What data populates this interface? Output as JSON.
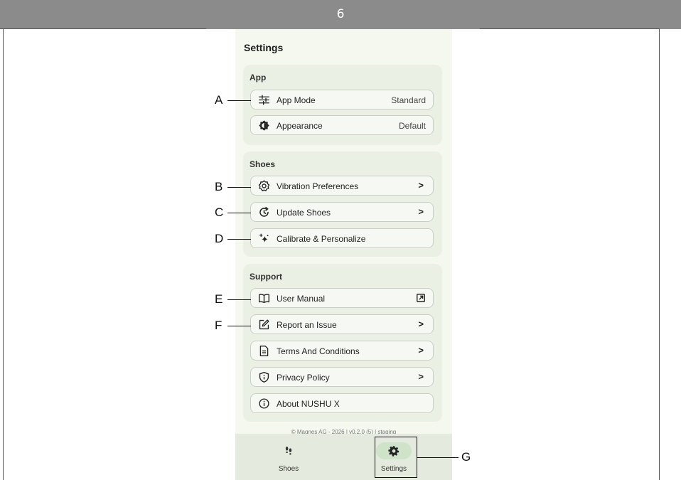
{
  "doc": {
    "page_number": "6"
  },
  "screen": {
    "title": "Settings",
    "sections": [
      {
        "title": "App",
        "rows": [
          {
            "label": "App Mode",
            "value": "Standard",
            "icon": "sliders-icon"
          },
          {
            "label": "Appearance",
            "value": "Default",
            "icon": "appearance-icon"
          }
        ]
      },
      {
        "title": "Shoes",
        "rows": [
          {
            "label": "Vibration Preferences",
            "chevron": ">",
            "icon": "vibration-icon"
          },
          {
            "label": "Update Shoes",
            "chevron": ">",
            "icon": "update-icon"
          },
          {
            "label": "Calibrate & Personalize",
            "icon": "sparkle-icon"
          }
        ]
      },
      {
        "title": "Support",
        "rows": [
          {
            "label": "User Manual",
            "icon": "book-icon",
            "trailing_icon": "external-link-icon"
          },
          {
            "label": "Report an Issue",
            "chevron": ">",
            "icon": "edit-icon"
          },
          {
            "label": "Terms And Conditions",
            "chevron": ">",
            "icon": "document-icon"
          },
          {
            "label": "Privacy Policy",
            "chevron": ">",
            "icon": "shield-icon"
          },
          {
            "label": "About NUSHU X",
            "icon": "info-icon"
          }
        ]
      }
    ],
    "copyright": "© Magnes AG - 2026 | v0.2.0 (5) | staging",
    "nav": [
      {
        "label": "Shoes",
        "icon": "footprints-icon",
        "active": false
      },
      {
        "label": "Settings",
        "icon": "gear-icon",
        "active": true
      }
    ]
  },
  "callouts": [
    "A",
    "B",
    "C",
    "D",
    "E",
    "F",
    "G"
  ],
  "colors": {
    "header": "#8b8b8b",
    "screen_bg": "#f4f8ef",
    "section_bg": "#eaf0e4",
    "nav_bg": "#e4ebde",
    "active_pill": "#cfe3c9"
  }
}
